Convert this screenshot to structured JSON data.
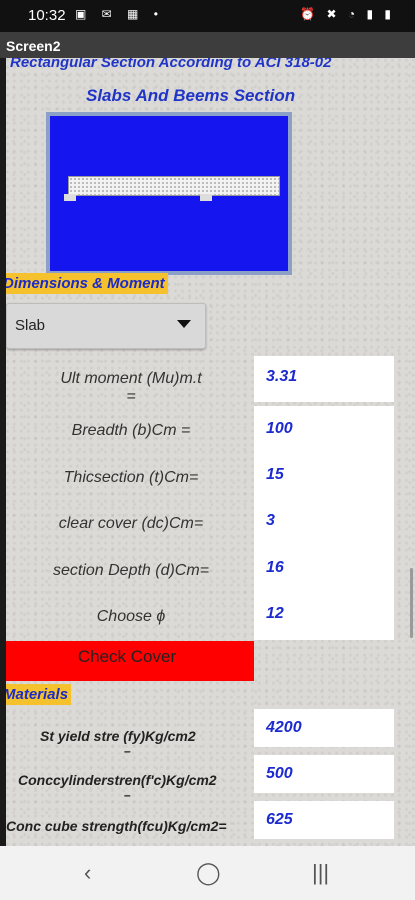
{
  "status_bar": {
    "time": "10:32",
    "left_icons": "▣ ✉ ▦ •",
    "right_icons": "⏰ ✖ ◔ ▮ ▮"
  },
  "title_bar": {
    "title": "Screen2"
  },
  "header": {
    "title": "Rectangular Section According to ACI 318-02",
    "subtitle": "Slabs And Beems Section"
  },
  "section_dimensions": {
    "label": "Dimensions & Moment"
  },
  "dropdown": {
    "selected": "Slab"
  },
  "fields": [
    {
      "label": "Ult moment (Mu)m.t\n=",
      "value": "3.31"
    },
    {
      "label": "Breadth  (b)Cm =",
      "value": "100"
    },
    {
      "label": "Thicsection (t)Cm=",
      "value": "15"
    },
    {
      "label": "clear cover (dc)Cm=",
      "value": "3"
    },
    {
      "label": "section Depth (d)Cm=",
      "value": "16"
    },
    {
      "label": "Choose ϕ",
      "value": "12"
    }
  ],
  "check_button": {
    "label": "Check Cover"
  },
  "section_materials": {
    "label": "Materials"
  },
  "materials": [
    {
      "label": "St yield stre (fy)Kg/cm2",
      "value": "4200"
    },
    {
      "label": "Conccylinderstren(f'c)Kg/cm2",
      "value": "500"
    },
    {
      "label": "Conc cube strength(fcu)Kg/cm2=",
      "value": "625"
    }
  ],
  "nav_bar": {
    "back": "‹",
    "home": "◯",
    "recents": "|||"
  },
  "colors": {
    "accent_blue": "#2035c8",
    "tag_yellow": "#f5c22e",
    "check_red": "#ff0000",
    "image_blue": "#1515f0"
  }
}
